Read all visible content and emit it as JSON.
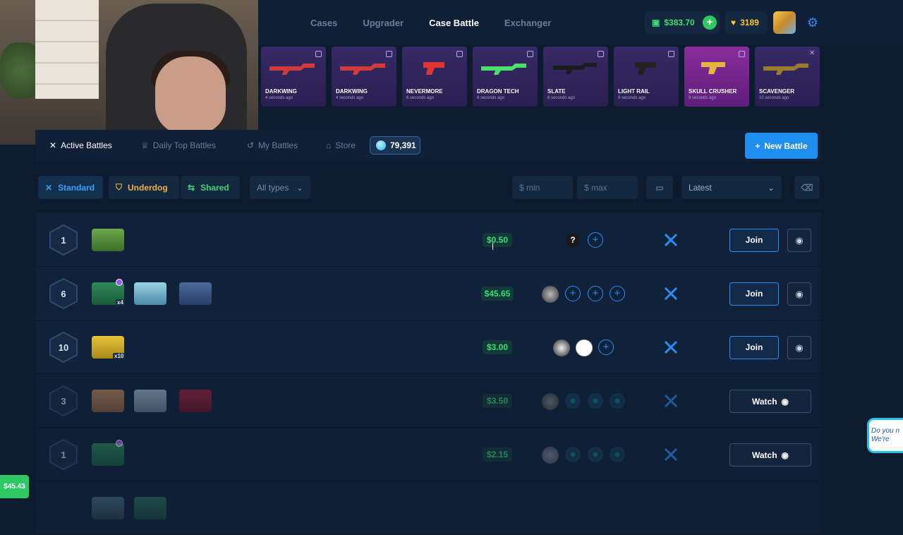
{
  "header": {
    "nav": [
      "Cases",
      "Upgrader",
      "Case Battle",
      "Exchanger"
    ],
    "balance": "$383.70",
    "coins": "3189"
  },
  "live_drops": [
    {
      "name": "DARKWING",
      "time": "4 seconds ago",
      "color": "#3a2a6e",
      "gun": "#d33b3b"
    },
    {
      "name": "DARKWING",
      "time": "4 seconds ago",
      "color": "#3a2a6e",
      "gun": "#d33b3b"
    },
    {
      "name": "NEVERMORE",
      "time": "6 seconds ago",
      "color": "#3a2a6e",
      "gun": "#e03434"
    },
    {
      "name": "DRAGON TECH",
      "time": "8 seconds ago",
      "color": "#3a2a6e",
      "gun": "#4ce06b"
    },
    {
      "name": "SLATE",
      "time": "8 seconds ago",
      "color": "#3a2a6e",
      "gun": "#1b1b22"
    },
    {
      "name": "LIGHT RAIL",
      "time": "9 seconds ago",
      "color": "#3a2a6e",
      "gun": "#222"
    },
    {
      "name": "SKULL CRUSHER",
      "time": "9 seconds ago",
      "color": "#7a2a8e",
      "gun": "#e6b63a"
    },
    {
      "name": "SCAVENGER",
      "time": "10 seconds ago",
      "color": "#3a2a6e",
      "gun": "#9a7a2e"
    }
  ],
  "tabs": [
    "Active Battles",
    "Daily Top Battles",
    "My Battles",
    "Store"
  ],
  "gems": "79,391",
  "new_battle": "New Battle",
  "filters": {
    "standard": "Standard",
    "underdog": "Underdog",
    "shared": "Shared",
    "types": "All types",
    "min_placeholder": "$ min",
    "max_placeholder": "$ max",
    "sort": "Latest"
  },
  "battles": [
    {
      "round": "1",
      "price": "$0.50",
      "action": "Join"
    },
    {
      "round": "6",
      "price": "$45.65",
      "action": "Join"
    },
    {
      "round": "10",
      "price": "$3.00",
      "action": "Join"
    },
    {
      "round": "3",
      "price": "$3.50",
      "action": "Watch"
    },
    {
      "round": "1",
      "price": "$2.15",
      "action": "Watch"
    }
  ],
  "case_qty": {
    "r2": "x4",
    "r3": "x10"
  },
  "unknown": "?",
  "toast": "$45.43",
  "chat": "Do you n\nWe're"
}
